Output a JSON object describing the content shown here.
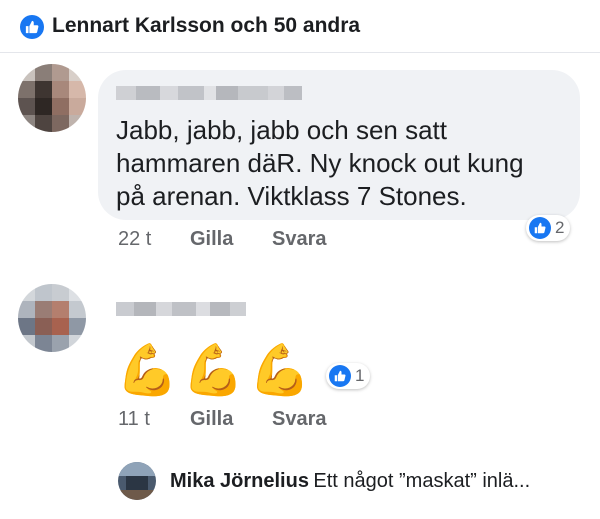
{
  "header": {
    "reactions_text": "Lennart Karlsson och 50 andra",
    "like_color": "#1877f2"
  },
  "comments": [
    {
      "text_lines": [
        "Jabb, jabb, jabb och sen satt",
        "hammaren däR. Ny knock out kung",
        "på arenan. Viktklass 7 Stones."
      ],
      "time": "22 t",
      "like_label": "Gilla",
      "reply_label": "Svara",
      "reaction_count": "2"
    },
    {
      "emoji": "💪💪💪",
      "time": "11 t",
      "like_label": "Gilla",
      "reply_label": "Svara",
      "reaction_count": "1"
    }
  ],
  "reply_preview": {
    "name": "Mika Jörnelius",
    "text": "Ett något ”maskat” inlä..."
  }
}
